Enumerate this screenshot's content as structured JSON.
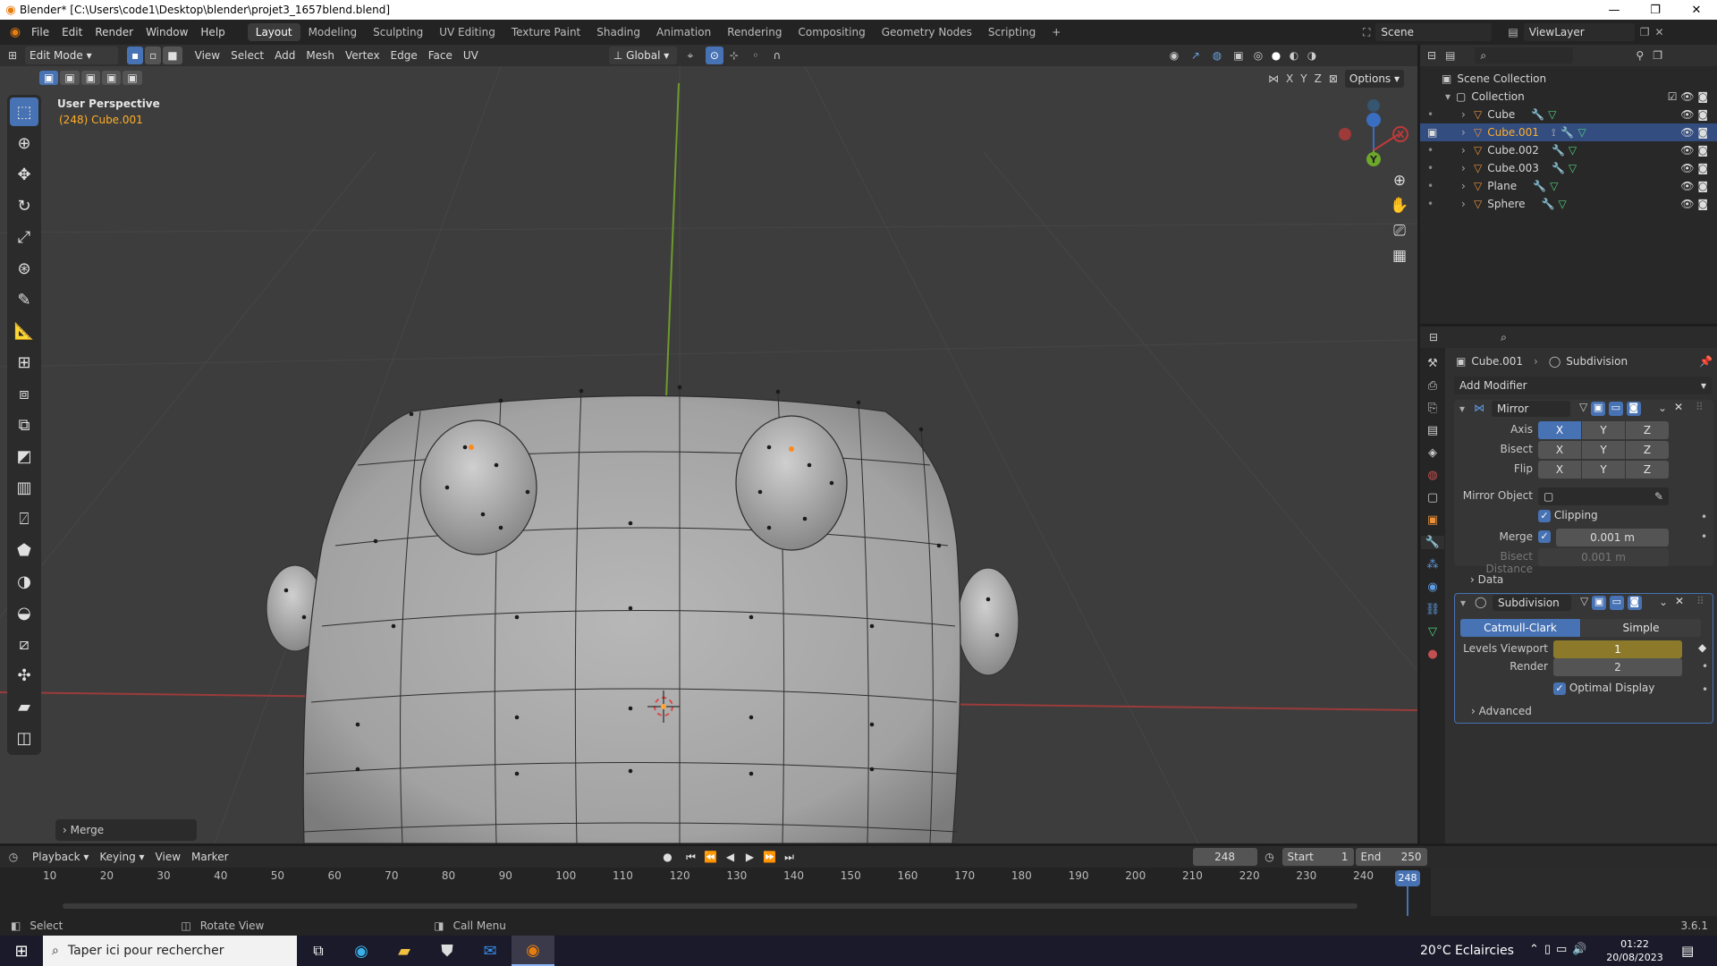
{
  "window": {
    "title": "Blender* [C:\\Users\\code1\\Desktop\\blender\\projet3_1657blend.blend]"
  },
  "menu": [
    "File",
    "Edit",
    "Render",
    "Window",
    "Help"
  ],
  "workspaces": [
    "Layout",
    "Modeling",
    "Sculpting",
    "UV Editing",
    "Texture Paint",
    "Shading",
    "Animation",
    "Rendering",
    "Compositing",
    "Geometry Nodes",
    "Scripting"
  ],
  "active_workspace": "Layout",
  "scene": {
    "name": "Scene",
    "view_layer": "ViewLayer"
  },
  "viewport": {
    "mode": "Edit Mode",
    "menus": [
      "View",
      "Select",
      "Add",
      "Mesh",
      "Vertex",
      "Edge",
      "Face",
      "UV"
    ],
    "orientation": "Global",
    "overlay_title": "User Perspective",
    "overlay_object": "(248) Cube.001",
    "options": "Options",
    "axes": [
      "X",
      "Y",
      "Z"
    ],
    "last_op": "Merge"
  },
  "outliner": {
    "scene_collection": "Scene Collection",
    "collection": "Collection",
    "items": [
      {
        "name": "Cube",
        "selected": false
      },
      {
        "name": "Cube.001",
        "selected": true
      },
      {
        "name": "Cube.002",
        "selected": false
      },
      {
        "name": "Cube.003",
        "selected": false
      },
      {
        "name": "Plane",
        "selected": false
      },
      {
        "name": "Sphere",
        "selected": false
      }
    ]
  },
  "properties": {
    "object": "Cube.001",
    "modifier": "Subdivision",
    "add_modifier": "Add Modifier",
    "mirror": {
      "name": "Mirror",
      "axis_label": "Axis",
      "bisect_label": "Bisect",
      "flip_label": "Flip",
      "xyz": [
        "X",
        "Y",
        "Z"
      ],
      "mirror_object_label": "Mirror Object",
      "clipping": "Clipping",
      "merge_label": "Merge",
      "merge_value": "0.001 m",
      "bisect_distance_label": "Bisect Distance",
      "bisect_distance_value": "0.001 m",
      "data": "Data"
    },
    "subdivision": {
      "name": "Subdivision",
      "catmull": "Catmull-Clark",
      "simple": "Simple",
      "levels_label": "Levels Viewport",
      "levels_value": "1",
      "render_label": "Render",
      "render_value": "2",
      "optimal": "Optimal Display",
      "advanced": "Advanced"
    }
  },
  "timeline": {
    "menus": [
      "Playback",
      "Keying",
      "View",
      "Marker"
    ],
    "current": "248",
    "start_label": "Start",
    "start": "1",
    "end_label": "End",
    "end": "250",
    "ticks": [
      "10",
      "20",
      "30",
      "40",
      "50",
      "60",
      "70",
      "80",
      "90",
      "100",
      "110",
      "120",
      "130",
      "140",
      "150",
      "160",
      "170",
      "180",
      "190",
      "200",
      "210",
      "220",
      "230",
      "240"
    ],
    "playhead": "248"
  },
  "status": {
    "select": "Select",
    "rotate": "Rotate View",
    "call_menu": "Call Menu",
    "version": "3.6.1"
  },
  "taskbar": {
    "search": "Taper ici pour rechercher",
    "weather": "20°C  Eclaircies",
    "time": "01:22",
    "date": "20/08/2023"
  },
  "colors": {
    "accent": "#4772b3",
    "selected_row": "#334d80",
    "active_object": "#ffaf29",
    "viewport_bg": "#3d3d3d"
  }
}
